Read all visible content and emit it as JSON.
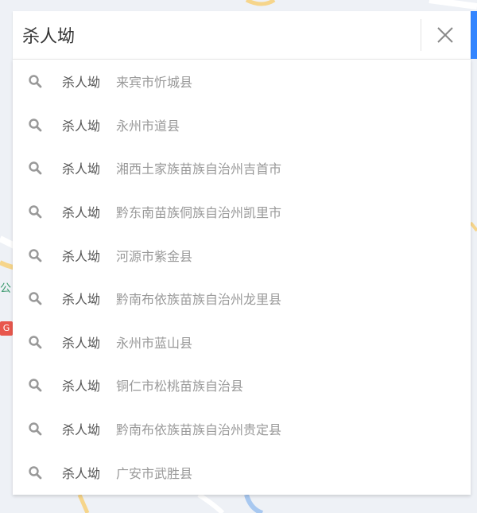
{
  "search": {
    "query": "杀人坳",
    "clear_icon": "close-icon"
  },
  "suggestions": [
    {
      "name": "杀人坳",
      "region": "来宾市忻城县"
    },
    {
      "name": "杀人坳",
      "region": "永州市道县"
    },
    {
      "name": "杀人坳",
      "region": "湘西土家族苗族自治州吉首市"
    },
    {
      "name": "杀人坳",
      "region": "黔东南苗族侗族自治州凯里市"
    },
    {
      "name": "杀人坳",
      "region": "河源市紫金县"
    },
    {
      "name": "杀人坳",
      "region": "黔南布依族苗族自治州龙里县"
    },
    {
      "name": "杀人坳",
      "region": "永州市蓝山县"
    },
    {
      "name": "杀人坳",
      "region": "铜仁市松桃苗族自治县"
    },
    {
      "name": "杀人坳",
      "region": "黔南布依族苗族自治州贵定县"
    },
    {
      "name": "杀人坳",
      "region": "广安市武胜县"
    }
  ],
  "map": {
    "road_label": "公",
    "badge": "G"
  },
  "colors": {
    "accent": "#3385ff",
    "road": "#f6d58b",
    "badge": "#e8574d",
    "icon": "#999999"
  }
}
